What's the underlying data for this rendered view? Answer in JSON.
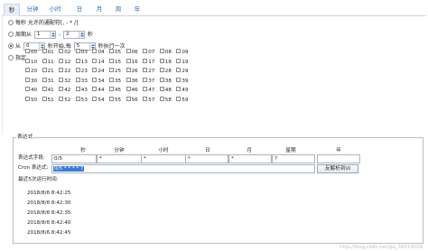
{
  "tabs": [
    "秒",
    "分钟",
    "小时",
    "日",
    "月",
    "周",
    "年"
  ],
  "active_tab": "秒",
  "options": {
    "every": "每秒 允许的通配符[, - * /]",
    "cycle_prefix": "周期从",
    "cycle_from": "1",
    "cycle_dash": "-",
    "cycle_to": "2",
    "cycle_unit": "秒",
    "from_prefix": "从",
    "from_start": "0",
    "from_mid": "秒开始,每",
    "from_every": "5",
    "from_suffix": "秒执行一次",
    "specify": "指定"
  },
  "seconds": [
    "00",
    "01",
    "02",
    "03",
    "04",
    "05",
    "06",
    "07",
    "08",
    "09",
    "10",
    "11",
    "12",
    "13",
    "14",
    "15",
    "16",
    "17",
    "18",
    "19",
    "20",
    "21",
    "22",
    "23",
    "24",
    "25",
    "26",
    "27",
    "28",
    "29",
    "30",
    "31",
    "32",
    "33",
    "34",
    "35",
    "36",
    "37",
    "38",
    "39",
    "40",
    "41",
    "42",
    "43",
    "44",
    "45",
    "46",
    "47",
    "48",
    "49",
    "50",
    "51",
    "52",
    "53",
    "54",
    "55",
    "56",
    "57",
    "58",
    "59"
  ],
  "expression": {
    "legend": "表达式",
    "columns": [
      "秒",
      "分钟",
      "小时",
      "日",
      "月",
      "星期",
      "年"
    ],
    "field_label": "表达式字段:",
    "fields": [
      "0/5",
      "*",
      "*",
      "*",
      "*",
      "?",
      ""
    ],
    "cron_label": "Cron 表达式:",
    "cron_value": "0/5 * * * * ?",
    "parse_button": "反解析到UI",
    "recent_label": "最近5次运行时间:",
    "runs": [
      "2018/8/6 8:42:25",
      "2018/8/6 8:42:30",
      "2018/8/6 8:42:35",
      "2018/8/6 8:42:40",
      "2018/8/6 8:42:45"
    ]
  },
  "watermark": "http://blog.csdn.net/qq_36014509"
}
